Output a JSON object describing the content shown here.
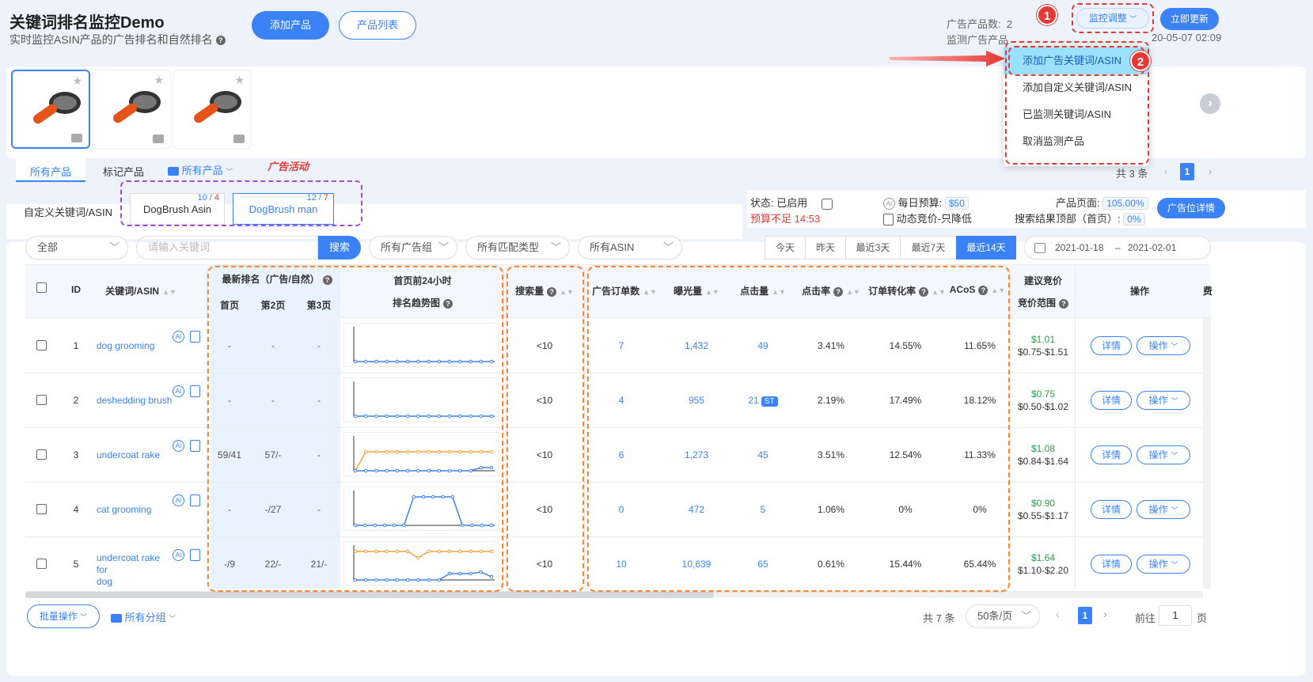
{
  "header": {
    "title": "关键词排名监控Demo",
    "subtitle": "实时监控ASIN产品的广告排名和自然排名",
    "add_product": "添加产品",
    "product_list": "产品列表",
    "ad_product_count_label": "广告产品数:",
    "ad_product_count": "2",
    "monitor_label": "监测广告产品",
    "monitor_time": "20-05-07 02:09",
    "monitor_adjust": "监控调整",
    "update_now": "立即更新"
  },
  "annotations": {
    "badge1": "1",
    "badge2": "2",
    "ad_activity": "广告活动"
  },
  "dropdown": {
    "items": [
      "添加广告关键词/ASIN",
      "添加自定义关键词/ASIN",
      "已监测关键词/ASIN",
      "取消监测产品"
    ]
  },
  "filter_tabs": {
    "all": "所有产品",
    "marked": "标记产品",
    "all_group": "所有产品"
  },
  "pagination_top": {
    "total": "共 3 条",
    "page": "1"
  },
  "campaigns": {
    "custom": "自定义关键词/ASIN",
    "items": [
      {
        "name": "DogBrush Asin",
        "count_a": "10",
        "count_b": "4"
      },
      {
        "name": "DogBrush man",
        "count_a": "12",
        "count_b": "7"
      }
    ]
  },
  "status": {
    "state_label": "状态:",
    "state_value": "已启用",
    "budget_warn": "预算不足 14:53",
    "daily_budget_label": "每日预算:",
    "daily_budget": "$50",
    "bid_strategy": "动态竞价-只降低",
    "product_page_label": "产品页面:",
    "product_page": "105.00%",
    "top_search_label": "搜索结果顶部（首页）:",
    "top_search": "0%",
    "placement_details": "广告位详情"
  },
  "filters": {
    "all": "全部",
    "search_placeholder": "请输入关键词",
    "search": "搜索",
    "ad_group": "所有广告组",
    "match_type": "所有匹配类型",
    "asin": "所有ASIN",
    "ranges": [
      "今天",
      "昨天",
      "最近3天",
      "最近7天",
      "最近14天"
    ],
    "active_range": 4,
    "date_from": "2021-01-18",
    "date_sep": "–",
    "date_to": "2021-02-01"
  },
  "table": {
    "headers": {
      "id": "ID",
      "keyword": "关键词/ASIN",
      "latest_rank": "最新排名（广告/自然）",
      "page1": "首页",
      "page2": "第2页",
      "page3": "第3页",
      "trend_title": "首页前24小时",
      "trend_sub": "排名趋势图",
      "search_vol": "搜索量",
      "orders": "广告订单数",
      "impressions": "曝光量",
      "clicks": "点击量",
      "ctr": "点击率",
      "cvr": "订单转化率",
      "acos": "ACoS",
      "bid_title": "建议竞价",
      "bid_sub": "竞价范围",
      "ops": "操作",
      "extra": "费"
    },
    "rows": [
      {
        "id": "1",
        "kw": "dog grooming",
        "kw2": "",
        "p1": "-",
        "p2": "-",
        "p3": "-",
        "vol": "<10",
        "orders": "7",
        "imp": "1,432",
        "clicks": "49",
        "st": "",
        "ctr": "3.41%",
        "cvr": "14.55%",
        "acos": "11.65%",
        "bid": "$1.01",
        "range": "$0.75-$1.51"
      },
      {
        "id": "2",
        "kw": "deshedding brush",
        "kw2": "",
        "p1": "-",
        "p2": "-",
        "p3": "-",
        "vol": "<10",
        "orders": "4",
        "imp": "955",
        "clicks": "21",
        "st": "ST",
        "ctr": "2.19%",
        "cvr": "17.49%",
        "acos": "18.12%",
        "bid": "$0.75",
        "range": "$0.50-$1.02"
      },
      {
        "id": "3",
        "kw": "undercoat rake",
        "kw2": "",
        "p1": "59/41",
        "p2": "57/-",
        "p3": "-",
        "vol": "<10",
        "orders": "6",
        "imp": "1,273",
        "clicks": "45",
        "st": "",
        "ctr": "3.51%",
        "cvr": "12.54%",
        "acos": "11.33%",
        "bid": "$1.08",
        "range": "$0.84-$1.64"
      },
      {
        "id": "4",
        "kw": "cat grooming",
        "kw2": "",
        "p1": "-",
        "p2": "-/27",
        "p3": "-",
        "vol": "<10",
        "orders": "0",
        "imp": "472",
        "clicks": "5",
        "st": "",
        "ctr": "1.06%",
        "cvr": "0%",
        "acos": "0%",
        "bid": "$0.90",
        "range": "$0.55-$1.17"
      },
      {
        "id": "5",
        "kw": "undercoat rake for",
        "kw2": "dog",
        "p1": "-/9",
        "p2": "22/-",
        "p3": "21/-",
        "vol": "<10",
        "orders": "10",
        "imp": "10,639",
        "clicks": "65",
        "st": "",
        "ctr": "0.61%",
        "cvr": "15.44%",
        "acos": "65.44%",
        "bid": "$1.64",
        "range": "$1.10-$2.20"
      }
    ],
    "detail_btn": "详情",
    "op_btn": "操作"
  },
  "footer": {
    "batch": "批量操作",
    "groups": "所有分组",
    "total": "共 7 条",
    "per_page": "50条/页",
    "page": "1",
    "goto_label": "前往",
    "goto_value": "1",
    "goto_unit": "页"
  },
  "colors": {
    "accent": "#3b82f6",
    "warning": "#e53935",
    "orange_series": "#f2a33d",
    "blue_series": "#3b82f6"
  }
}
